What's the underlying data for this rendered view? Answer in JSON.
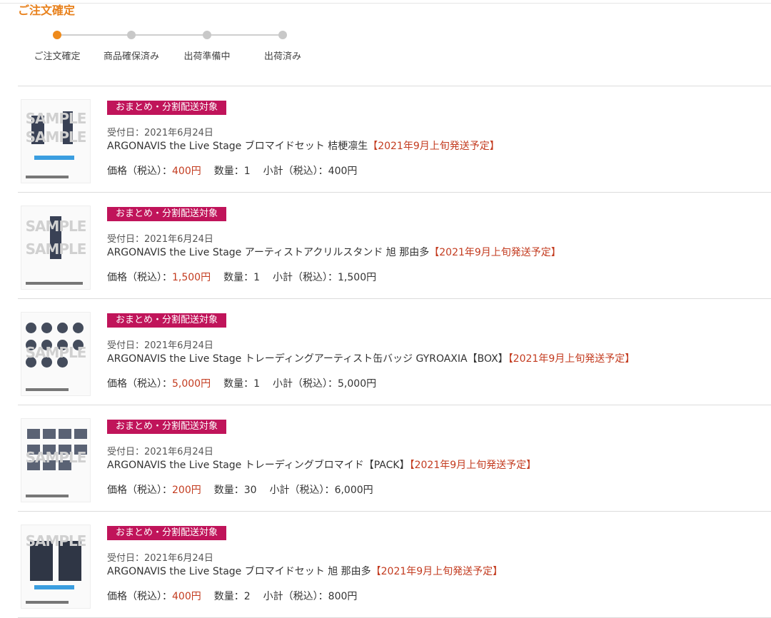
{
  "page": {
    "title": "ご注文確定"
  },
  "steps": [
    {
      "label": "ご注文確定",
      "active": true
    },
    {
      "label": "商品確保済み",
      "active": false
    },
    {
      "label": "出荷準備中",
      "active": false
    },
    {
      "label": "出荷済み",
      "active": false
    }
  ],
  "item_labels": {
    "badge": "おまとめ・分割配送対象",
    "price": "価格（税込）：",
    "qty": "数量：",
    "subtotal": "小計（税込）："
  },
  "items": [
    {
      "date": "受付日：2021年6月24日",
      "name": "ARGONAVIS the Live Stage ブロマイドセット 桔梗凛生",
      "ship": "【2021年9月上旬発送予定】",
      "price": "400円",
      "qty": "1",
      "subtotal": "400円"
    },
    {
      "date": "受付日：2021年6月24日",
      "name": "ARGONAVIS the Live Stage アーティストアクリルスタンド 旭 那由多",
      "ship": "【2021年9月上旬発送予定】",
      "price": "1,500円",
      "qty": "1",
      "subtotal": "1,500円"
    },
    {
      "date": "受付日：2021年6月24日",
      "name": "ARGONAVIS the Live Stage トレーディングアーティスト缶バッジ GYROAXIA【BOX】",
      "ship": "【2021年9月上旬発送予定】",
      "price": "5,000円",
      "qty": "1",
      "subtotal": "5,000円"
    },
    {
      "date": "受付日：2021年6月24日",
      "name": "ARGONAVIS the Live Stage トレーディングブロマイド【PACK】",
      "ship": "【2021年9月上旬発送予定】",
      "price": "200円",
      "qty": "30",
      "subtotal": "6,000円"
    },
    {
      "date": "受付日：2021年6月24日",
      "name": "ARGONAVIS the Live Stage ブロマイドセット 旭 那由多",
      "ship": "【2021年9月上旬発送予定】",
      "price": "400円",
      "qty": "2",
      "subtotal": "800円"
    }
  ],
  "thumb_watermark": "SAMPLE",
  "colors": {
    "accent": "#ee8a1b",
    "badge": "#c0145a",
    "price": "#c33b1f"
  }
}
